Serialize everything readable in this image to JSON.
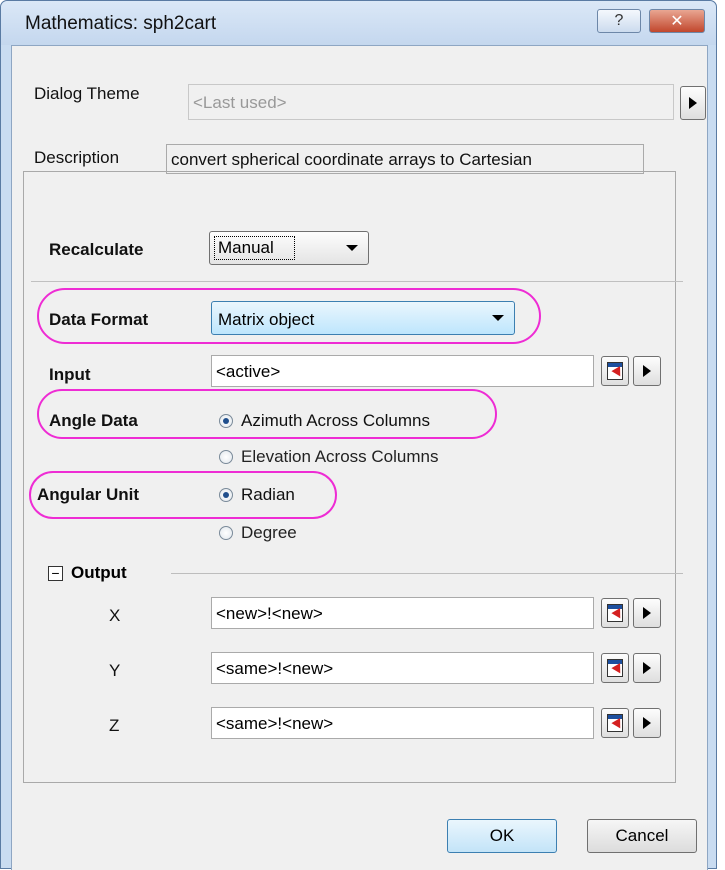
{
  "window": {
    "title": "Mathematics: sph2cart",
    "help_glyph": "?",
    "close_glyph": "✕"
  },
  "theme": {
    "label": "Dialog Theme",
    "value": "<Last used>"
  },
  "description": {
    "label": "Description",
    "value": "convert spherical coordinate arrays to Cartesian"
  },
  "recalculate": {
    "label": "Recalculate",
    "value": "Manual"
  },
  "data_format": {
    "label": "Data Format",
    "value": "Matrix object"
  },
  "input": {
    "label": "Input",
    "value": "<active>"
  },
  "angle_data": {
    "label": "Angle Data",
    "options": [
      "Azimuth Across Columns",
      "Elevation Across Columns"
    ],
    "selected": 0
  },
  "angular_unit": {
    "label": "Angular Unit",
    "options": [
      "Radian",
      "Degree"
    ],
    "selected": 0
  },
  "output": {
    "label": "Output",
    "collapse_glyph": "−",
    "rows": [
      {
        "label": "X",
        "value": "<new>!<new>"
      },
      {
        "label": "Y",
        "value": "<same>!<new>"
      },
      {
        "label": "Z",
        "value": "<same>!<new>"
      }
    ]
  },
  "buttons": {
    "ok": "OK",
    "cancel": "Cancel"
  },
  "colors": {
    "highlight_ellipse": "#ee2cd4",
    "titlebar": "#c4d7ee",
    "close_button": "#c1472d"
  },
  "icons": [
    "expand-arrow-icon",
    "dropdown-arrow-icon",
    "pick-column-icon",
    "radio-selected-icon",
    "collapse-box-icon"
  ]
}
